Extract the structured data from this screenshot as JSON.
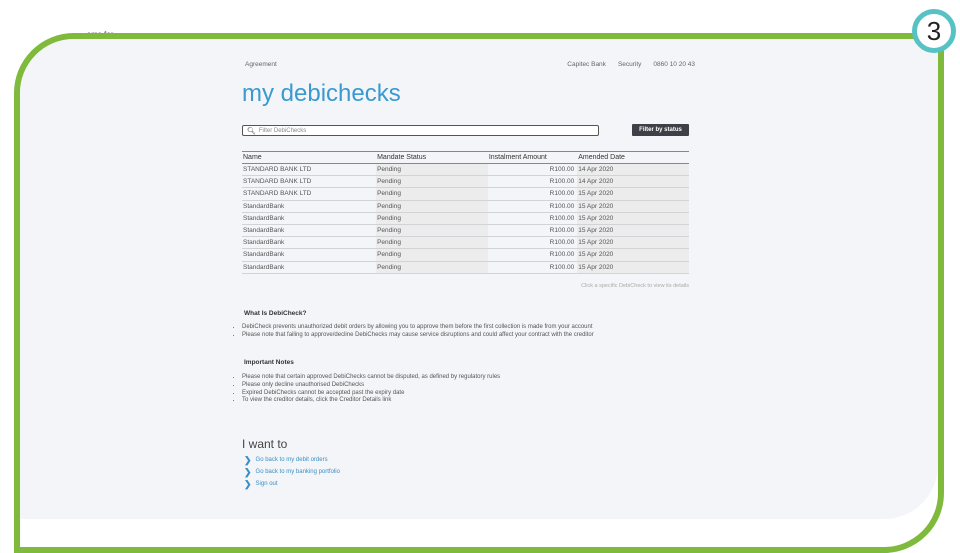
{
  "top_snippet": "...ems for...",
  "step_badge": "3",
  "header": {
    "left_link": "Agreement",
    "right_links": [
      "Capitec Bank",
      "Security",
      "0860 10 20 43"
    ]
  },
  "page_title": "my debichecks",
  "search": {
    "placeholder": "Filter DebiChecks"
  },
  "filter_button": "Filter by status",
  "table": {
    "columns": [
      "Name",
      "Mandate Status",
      "Instalment Amount",
      "Amended Date"
    ],
    "rows": [
      [
        "STANDARD BANK LTD",
        "Pending",
        "R100.00",
        "14 Apr 2020"
      ],
      [
        "STANDARD BANK LTD",
        "Pending",
        "R100.00",
        "14 Apr 2020"
      ],
      [
        "STANDARD BANK LTD",
        "Pending",
        "R100.00",
        "15 Apr 2020"
      ],
      [
        "StandardBank",
        "Pending",
        "R100.00",
        "15 Apr 2020"
      ],
      [
        "StandardBank",
        "Pending",
        "R100.00",
        "15 Apr 2020"
      ],
      [
        "StandardBank",
        "Pending",
        "R100.00",
        "15 Apr 2020"
      ],
      [
        "StandardBank",
        "Pending",
        "R100.00",
        "15 Apr 2020"
      ],
      [
        "StandardBank",
        "Pending",
        "R100.00",
        "15 Apr 2020"
      ],
      [
        "StandardBank",
        "Pending",
        "R100.00",
        "15 Apr 2020"
      ]
    ]
  },
  "hint": "Click a specific DebiCheck to view its details",
  "what_is": {
    "heading": "What Is DebiCheck?",
    "items": [
      "DebiCheck prevents unauthorized debit orders by allowing you to approve them before the first collection is made from your account",
      "Please note that failing to approve/decline DebiChecks may cause service disruptions and could affect your contract with the creditor"
    ]
  },
  "notes": {
    "heading": "Important Notes",
    "items": [
      "Please note that certain approved DebiChecks cannot be disputed, as defined by regulatory rules",
      "Please only decline unauthorised DebiChecks",
      "Expired DebiChecks cannot be accepted past the expiry date",
      "To view the creditor details, click the Creditor Details link"
    ]
  },
  "i_want_to": {
    "heading": "I want to",
    "links": [
      "Go back to my debit orders",
      "Go back to my banking portfolio",
      "Sign out"
    ]
  },
  "colors": {
    "frame": "#7fba3c",
    "badge": "#57c2c5",
    "title": "#3a9ad0"
  }
}
